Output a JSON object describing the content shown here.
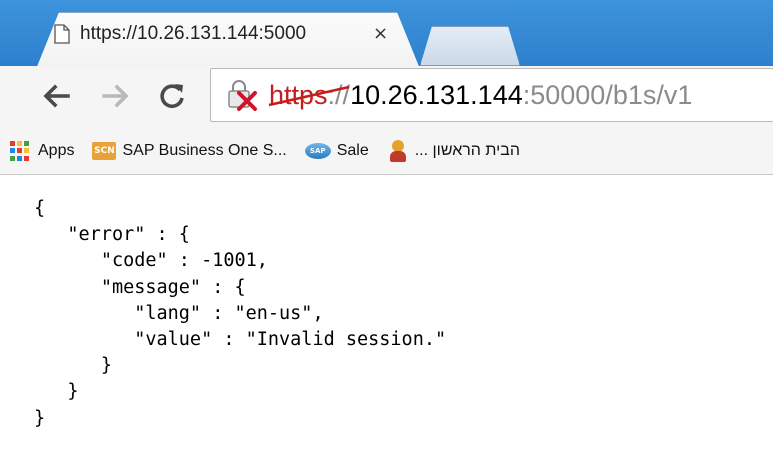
{
  "browser": {
    "tab": {
      "title": "https://10.26.131.144:5000",
      "close_icon": "×"
    },
    "toolbar": {
      "back_icon": "arrow-left",
      "forward_icon": "arrow-right",
      "reload_icon": "reload"
    },
    "address_bar": {
      "scheme": "https",
      "separator": "://",
      "host": "10.26.131.144",
      "port": ":50000",
      "path": "/b1s/v1",
      "security_state": "insecure-https"
    },
    "bookmarks": [
      {
        "label": "Apps",
        "icon": "apps-grid-icon"
      },
      {
        "label": "SAP Business One S...",
        "icon": "scn-icon"
      },
      {
        "label": "Sale",
        "icon": "sap-icon"
      },
      {
        "label": "הבית הראשון ...",
        "icon": "figure-icon"
      }
    ]
  },
  "content": {
    "json_text": "{\n   \"error\" : {\n      \"code\" : -1001,\n      \"message\" : {\n         \"lang\" : \"en-us\",\n         \"value\" : \"Invalid session.\"\n      }\n   }\n}"
  },
  "colors": {
    "titlebar": "#2d7fcb",
    "toolbar": "#f5f5f5",
    "scheme_error": "#c31f1f"
  }
}
